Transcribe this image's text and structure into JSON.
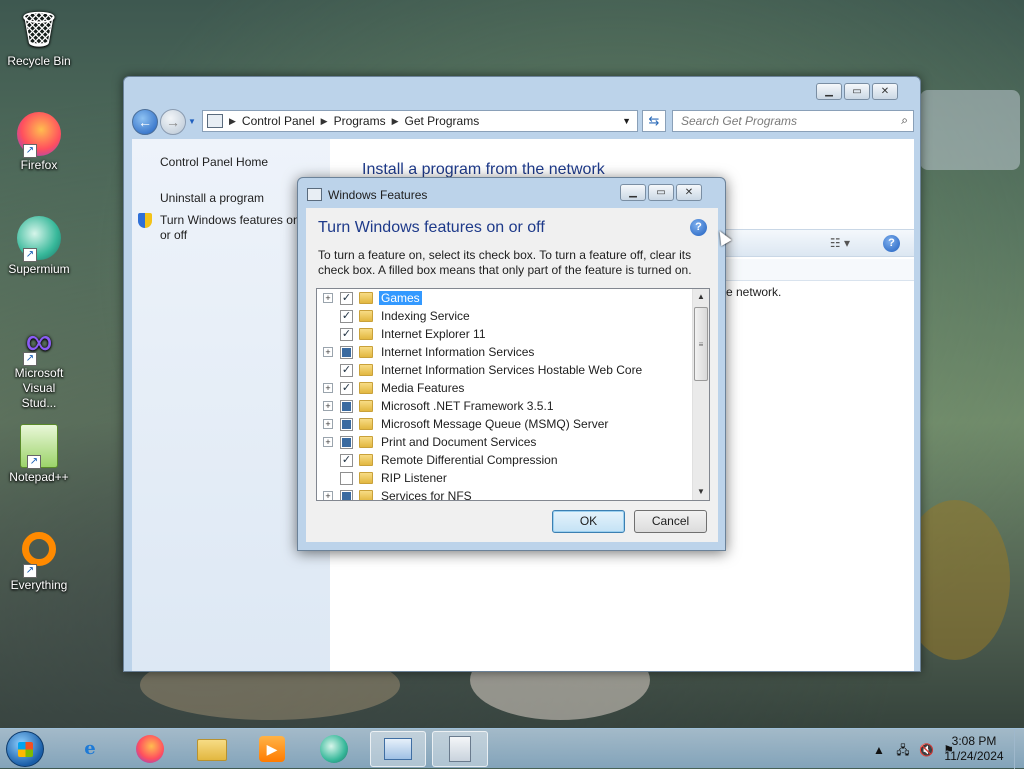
{
  "desktop": {
    "icons": [
      {
        "label": "Recycle Bin",
        "glyph": "🗑"
      },
      {
        "label": "Firefox",
        "glyph": "🦊"
      },
      {
        "label": "Supermium",
        "glyph": "◉"
      },
      {
        "label": "Microsoft Visual Stud...",
        "glyph": "∞"
      },
      {
        "label": "Notepad++",
        "glyph": "✎"
      },
      {
        "label": "Everything",
        "glyph": "○"
      }
    ]
  },
  "explorer": {
    "breadcrumb": [
      "Control Panel",
      "Programs",
      "Get Programs"
    ],
    "search_placeholder": "Search Get Programs",
    "left_links": [
      "Control Panel Home",
      "Uninstall a program",
      "Turn Windows features on or off"
    ],
    "heading": "Install a program from the network",
    "body_text": "e network."
  },
  "dialog": {
    "title": "Windows Features",
    "heading": "Turn Windows features on or off",
    "description": "To turn a feature on, select its check box. To turn a feature off, clear its check box. A filled box means that only part of the feature is turned on.",
    "features": [
      {
        "name": "Games",
        "state": "checked",
        "expandable": true,
        "selected": true
      },
      {
        "name": "Indexing Service",
        "state": "checked",
        "expandable": false
      },
      {
        "name": "Internet Explorer 11",
        "state": "checked",
        "expandable": false
      },
      {
        "name": "Internet Information Services",
        "state": "partial",
        "expandable": true
      },
      {
        "name": "Internet Information Services Hostable Web Core",
        "state": "checked",
        "expandable": false
      },
      {
        "name": "Media Features",
        "state": "checked",
        "expandable": true
      },
      {
        "name": "Microsoft .NET Framework 3.5.1",
        "state": "partial",
        "expandable": true
      },
      {
        "name": "Microsoft Message Queue (MSMQ) Server",
        "state": "partial",
        "expandable": true
      },
      {
        "name": "Print and Document Services",
        "state": "partial",
        "expandable": true
      },
      {
        "name": "Remote Differential Compression",
        "state": "checked",
        "expandable": false
      },
      {
        "name": "RIP Listener",
        "state": "unchecked",
        "expandable": false
      },
      {
        "name": "Services for NFS",
        "state": "partial",
        "expandable": true
      }
    ],
    "ok_label": "OK",
    "cancel_label": "Cancel"
  },
  "taskbar": {
    "apps": [
      "internet-explorer-icon",
      "firefox-icon",
      "file-explorer-icon",
      "media-player-icon",
      "supermium-icon",
      "control-panel-icon",
      "windows-features-icon"
    ],
    "time": "3:08 PM",
    "date": "11/24/2024"
  }
}
